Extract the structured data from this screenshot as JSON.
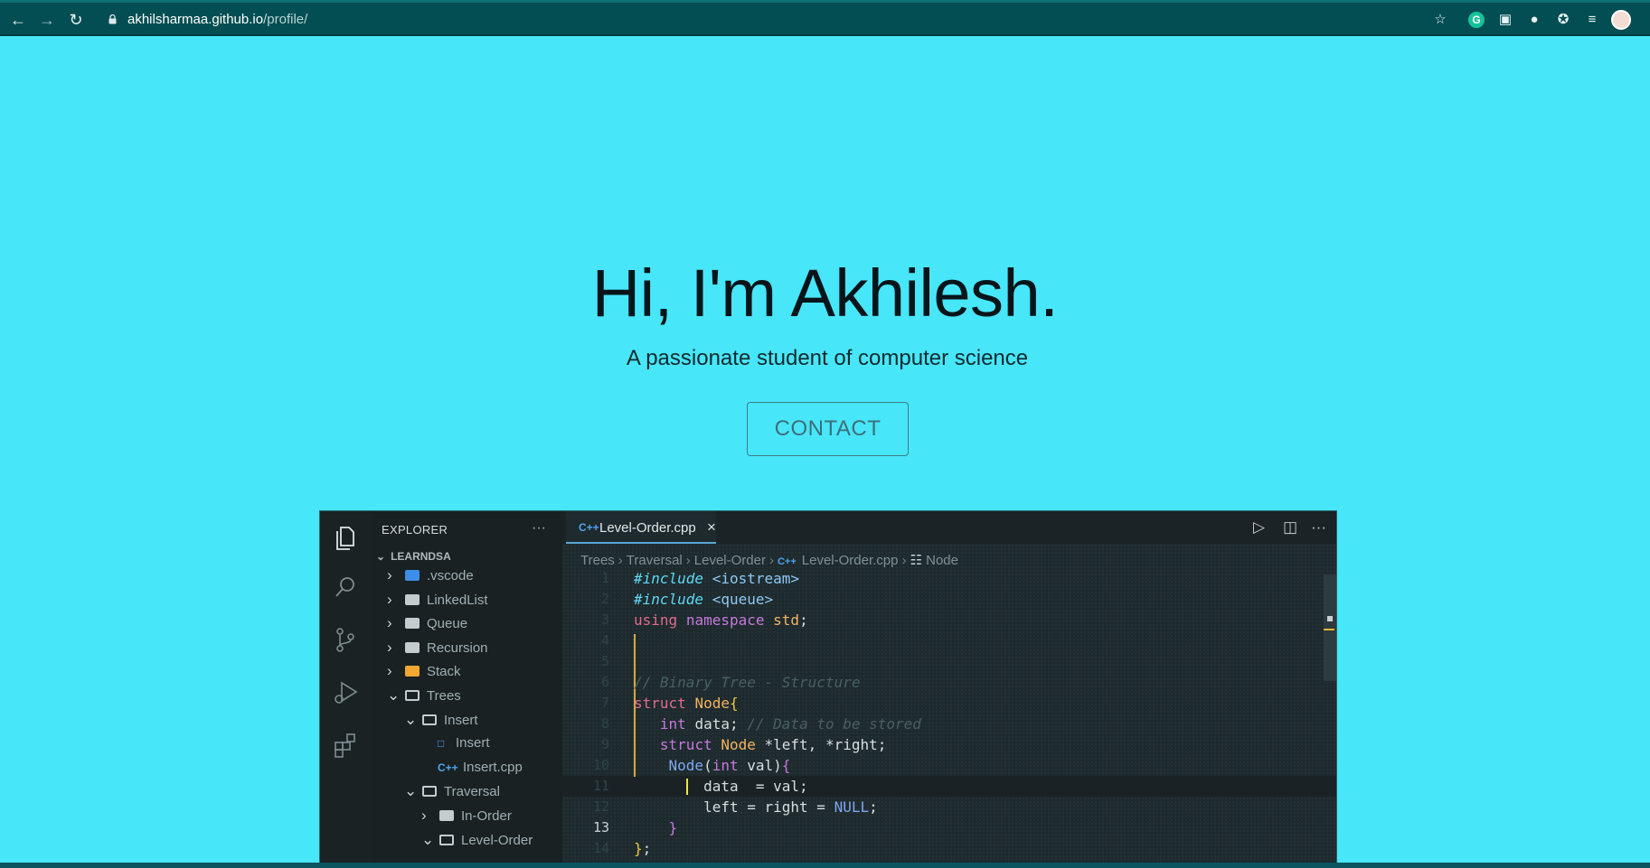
{
  "browser": {
    "url_host": "akhilsharmaa.github.io",
    "url_path": "/profile/"
  },
  "hero": {
    "title": "Hi, I'm Akhilesh.",
    "subtitle": "A passionate student of computer science",
    "contact_label": "CONTACT"
  },
  "vscode": {
    "explorer_title": "EXPLORER",
    "explorer_more": "···",
    "workspace": "LEARNDSA",
    "tree": [
      {
        "label": ".vscode",
        "kind": "folder-blue",
        "level": 0,
        "chev": ">"
      },
      {
        "label": "LinkedList",
        "kind": "folder",
        "level": 0,
        "chev": ">"
      },
      {
        "label": "Queue",
        "kind": "folder",
        "level": 0,
        "chev": ">"
      },
      {
        "label": "Recursion",
        "kind": "folder",
        "level": 0,
        "chev": ">"
      },
      {
        "label": "Stack",
        "kind": "folder-orange",
        "level": 0,
        "chev": ">"
      },
      {
        "label": "Trees",
        "kind": "folder-open",
        "level": 0,
        "chev": "v"
      },
      {
        "label": "Insert",
        "kind": "folder-open",
        "level": 1,
        "chev": "v"
      },
      {
        "label": "Insert",
        "kind": "file",
        "level": 2,
        "chev": ""
      },
      {
        "label": "Insert.cpp",
        "kind": "cpp",
        "level": 2,
        "chev": ""
      },
      {
        "label": "Traversal",
        "kind": "folder-open",
        "level": 1,
        "chev": "v"
      },
      {
        "label": "In-Order",
        "kind": "folder",
        "level": 2,
        "chev": ">"
      },
      {
        "label": "Level-Order",
        "kind": "folder-open",
        "level": 2,
        "chev": "v"
      }
    ],
    "tab": {
      "label": "Level-Order.cpp",
      "close": "×",
      "icon": "C++"
    },
    "breadcrumbs": [
      "Trees",
      "Traversal",
      "Level-Order",
      "Level-Order.cpp",
      "Node"
    ],
    "code_lines": [
      {
        "n": "1",
        "html": "<span class=\"inc\">#include</span> <span class=\"str\">&lt;iostream&gt;</span>"
      },
      {
        "n": "2",
        "html": "<span class=\"inc\">#include</span> <span class=\"str\">&lt;queue&gt;</span>"
      },
      {
        "n": "3",
        "html": "<span class=\"kw2\">using</span> <span class=\"kw\">namespace</span> <span class=\"ty\">std</span><span class=\"plain\">;</span>"
      },
      {
        "n": "4",
        "html": ""
      },
      {
        "n": "5",
        "html": ""
      },
      {
        "n": "6",
        "html": "<span class=\"cm\">// Binary Tree - Structure</span>"
      },
      {
        "n": "7",
        "html": "<span class=\"kw2\">struct</span> <span class=\"ty\">Node</span><span class=\"brace\">{</span>"
      },
      {
        "n": "8",
        "html": "   <span class=\"kw\">int</span> <span class=\"plain\">data;</span> <span class=\"cm\">// Data to be stored</span>"
      },
      {
        "n": "9",
        "html": "   <span class=\"kw\">struct</span> <span class=\"ty\">Node</span> <span class=\"plain\">*left, *right;</span>"
      },
      {
        "n": "10",
        "html": "    <span class=\"fn\">Node</span><span class=\"plain\">(</span><span class=\"kw\">int</span> <span class=\"plain\">val)</span><span class=\"kw\">{</span>"
      },
      {
        "n": "11",
        "html": "        <span class=\"plain\">data  = val;</span>"
      },
      {
        "n": "12",
        "html": "        <span class=\"plain\">left = right = </span><span class=\"nul\">NULL</span><span class=\"plain\">;</span>"
      },
      {
        "n": "13",
        "html": "    <span class=\"kw\">}</span>"
      },
      {
        "n": "14",
        "html": "<span class=\"brace\">}</span><span class=\"plain\">;</span>"
      }
    ]
  }
}
